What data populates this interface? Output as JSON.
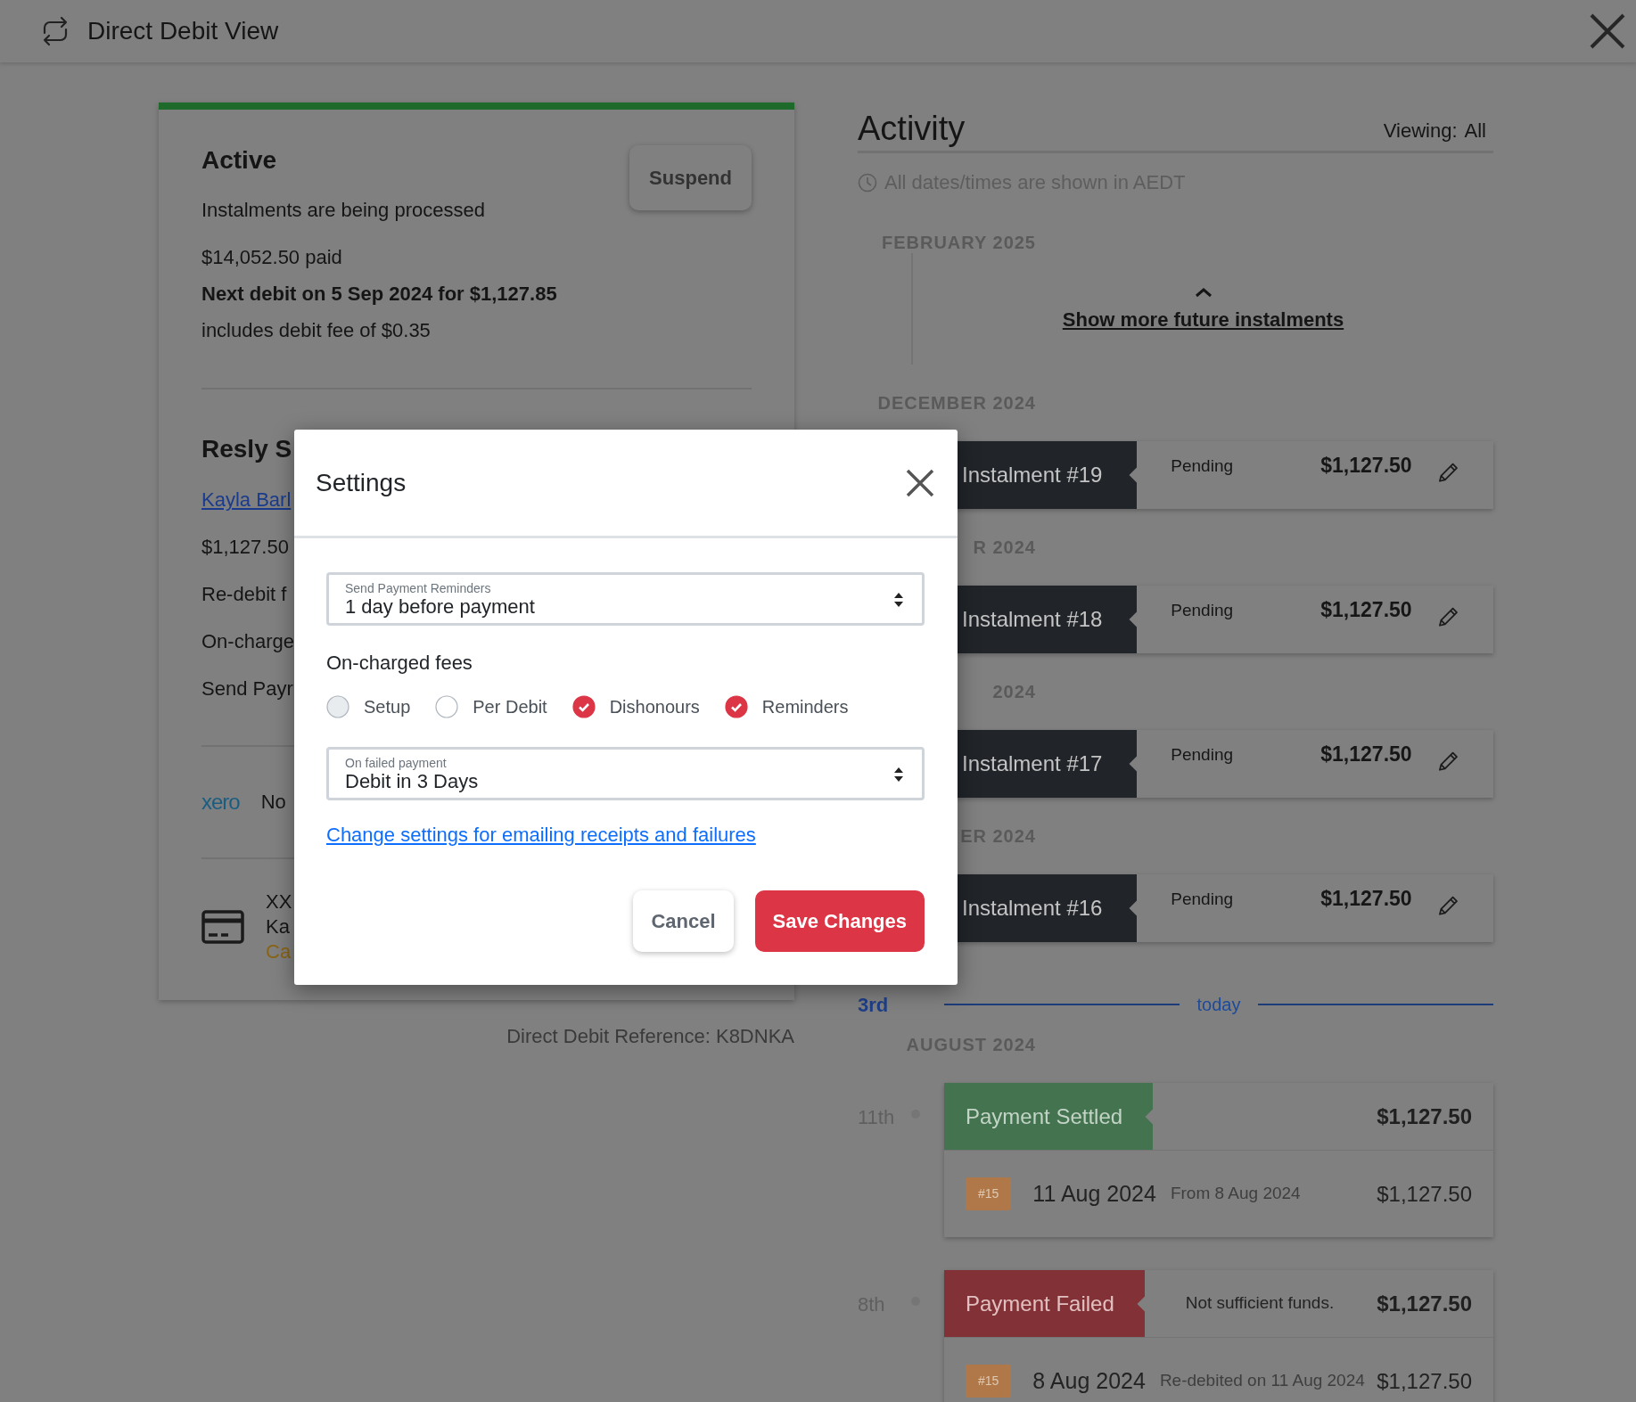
{
  "header": {
    "title": "Direct Debit View"
  },
  "summary": {
    "title": "Active",
    "button": "Suspend",
    "lines": [
      {
        "text": "Instalments are being processed",
        "kind": "plain"
      },
      {
        "text": "$14,052.50 paid",
        "kind": "plain"
      },
      {
        "text": "Next debit on 5 Sep 2024 for $1,127.85",
        "kind": "strong"
      },
      {
        "text": "includes debit fee of $0.35",
        "kind": "plain"
      }
    ]
  },
  "subscription": {
    "title": "Resly S",
    "link": "Kayla Barl",
    "lines": [
      "$1,127.50",
      "Re-debit f",
      "On-charge",
      "Send Payr"
    ]
  },
  "integration": {
    "logo": "xero",
    "text": "No"
  },
  "payment_method": {
    "lines": [
      {
        "text": "XX",
        "kind": "plain"
      },
      {
        "text": "Ka",
        "kind": "plain"
      },
      {
        "text": "Ca",
        "kind": "warning"
      }
    ]
  },
  "reference": "Direct Debit Reference: K8DNKA",
  "activity": {
    "title": "Activity",
    "viewing_label": "Viewing:",
    "viewing_value": "All",
    "timezone_note": "All dates/times are shown in AEDT",
    "groups": [
      {
        "kind": "more",
        "month": "FEBRUARY 2025",
        "link": "Show more future instalments"
      },
      {
        "kind": "instalment",
        "month": "DECEMBER 2024",
        "title": "Instalment #19",
        "status": "Pending",
        "amount": "$1,127.50"
      },
      {
        "kind": "instalment",
        "month": "R 2024",
        "title": "Instalment #18",
        "status": "Pending",
        "amount": "$1,127.50"
      },
      {
        "kind": "instalment",
        "month": "2024",
        "title": "Instalment #17",
        "status": "Pending",
        "amount": "$1,127.50"
      },
      {
        "kind": "instalment",
        "month": "ER 2024",
        "title": "Instalment #16",
        "status": "Pending",
        "amount": "$1,127.50"
      },
      {
        "kind": "today",
        "day": "3rd",
        "label": "today"
      },
      {
        "kind": "events",
        "month": "AUGUST 2024",
        "events": [
          {
            "kind": "settled",
            "day": "11th",
            "status": "Payment Settled",
            "amount": "$1,127.50",
            "details": [
              {
                "badge": "#15",
                "date": "11 Aug 2024",
                "note": "From 8 Aug 2024",
                "amount": "$1,127.50"
              }
            ]
          },
          {
            "kind": "failed",
            "day": "8th",
            "status": "Payment Failed",
            "note": "Not sufficient funds.",
            "amount": "$1,127.50",
            "details": [
              {
                "badge": "#15",
                "date": "8 Aug 2024",
                "note": "Re-debited on 11 Aug 2024",
                "amount": "$1,127.50"
              }
            ]
          }
        ]
      }
    ]
  },
  "modal": {
    "title": "Settings",
    "reminder_field": {
      "label": "Send Payment Reminders",
      "value": "1 day before payment"
    },
    "fees_label": "On-charged fees",
    "fees": [
      {
        "label": "Setup",
        "checked": false,
        "disabled": true
      },
      {
        "label": "Per Debit",
        "checked": false,
        "disabled": false
      },
      {
        "label": "Dishonours",
        "checked": true,
        "disabled": false
      },
      {
        "label": "Reminders",
        "checked": true,
        "disabled": false
      }
    ],
    "failed_field": {
      "label": "On failed payment",
      "value": "Debit in 3 Days"
    },
    "link": "Change settings for emailing receipts and failures",
    "buttons": [
      {
        "label": "Cancel",
        "kind": "secondary"
      },
      {
        "label": "Save Changes",
        "kind": "primary"
      }
    ]
  }
}
